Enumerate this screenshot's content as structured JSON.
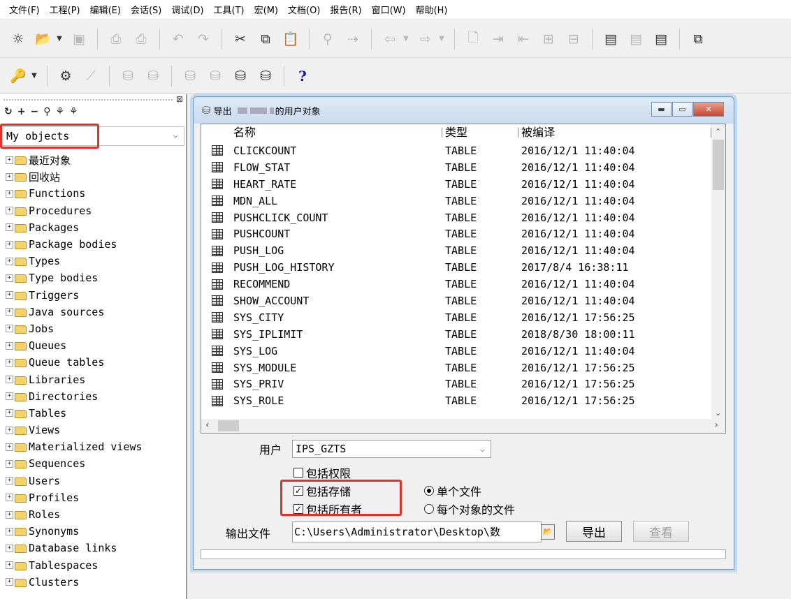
{
  "menu": [
    "文件(F)",
    "工程(P)",
    "编辑(E)",
    "会话(S)",
    "调试(D)",
    "工具(T)",
    "宏(M)",
    "文档(O)",
    "报告(R)",
    "窗口(W)",
    "帮助(H)"
  ],
  "toolbar2": {
    "help_label": "?"
  },
  "browser": {
    "selector_value": "My objects",
    "items": [
      "最近对象",
      "回收站",
      "Functions",
      "Procedures",
      "Packages",
      "Package bodies",
      "Types",
      "Type bodies",
      "Triggers",
      "Java sources",
      "Jobs",
      "Queues",
      "Queue tables",
      "Libraries",
      "Directories",
      "Tables",
      "Views",
      "Materialized views",
      "Sequences",
      "Users",
      "Profiles",
      "Roles",
      "Synonyms",
      "Database links",
      "Tablespaces",
      "Clusters"
    ]
  },
  "dialog": {
    "title_prefix": "导出",
    "title_suffix": "的用户对象",
    "columns": [
      "名称",
      "类型",
      "被编译"
    ],
    "rows": [
      {
        "name": "CLICKCOUNT",
        "type": "TABLE",
        "compiled": "2016/12/1 11:40:04"
      },
      {
        "name": "FLOW_STAT",
        "type": "TABLE",
        "compiled": "2016/12/1 11:40:04"
      },
      {
        "name": "HEART_RATE",
        "type": "TABLE",
        "compiled": "2016/12/1 11:40:04"
      },
      {
        "name": "MDN_ALL",
        "type": "TABLE",
        "compiled": "2016/12/1 11:40:04"
      },
      {
        "name": "PUSHCLICK_COUNT",
        "type": "TABLE",
        "compiled": "2016/12/1 11:40:04"
      },
      {
        "name": "PUSHCOUNT",
        "type": "TABLE",
        "compiled": "2016/12/1 11:40:04"
      },
      {
        "name": "PUSH_LOG",
        "type": "TABLE",
        "compiled": "2016/12/1 11:40:04"
      },
      {
        "name": "PUSH_LOG_HISTORY",
        "type": "TABLE",
        "compiled": "2017/8/4 16:38:11"
      },
      {
        "name": "RECOMMEND",
        "type": "TABLE",
        "compiled": "2016/12/1 11:40:04"
      },
      {
        "name": "SHOW_ACCOUNT",
        "type": "TABLE",
        "compiled": "2016/12/1 11:40:04"
      },
      {
        "name": "SYS_CITY",
        "type": "TABLE",
        "compiled": "2016/12/1 17:56:25"
      },
      {
        "name": "SYS_IPLIMIT",
        "type": "TABLE",
        "compiled": "2018/8/30 18:00:11"
      },
      {
        "name": "SYS_LOG",
        "type": "TABLE",
        "compiled": "2016/12/1 11:40:04"
      },
      {
        "name": "SYS_MODULE",
        "type": "TABLE",
        "compiled": "2016/12/1 17:56:25"
      },
      {
        "name": "SYS_PRIV",
        "type": "TABLE",
        "compiled": "2016/12/1 17:56:25"
      },
      {
        "name": "SYS_ROLE",
        "type": "TABLE",
        "compiled": "2016/12/1 17:56:25"
      }
    ],
    "user_label": "用户",
    "user_value": "IPS_GZTS",
    "include_privileges": {
      "label": "包括权限",
      "checked": false
    },
    "include_storage": {
      "label": "包括存储",
      "checked": true
    },
    "include_owner": {
      "label": "包括所有者",
      "checked": true
    },
    "single_file": {
      "label": "单个文件",
      "selected": true
    },
    "per_object_file": {
      "label": "每个对象的文件",
      "selected": false
    },
    "output_label": "输出文件",
    "output_value": "C:\\Users\\Administrator\\Desktop\\数",
    "export_label": "导出",
    "view_label": "查看",
    "highlight_color": "#e0312b"
  }
}
